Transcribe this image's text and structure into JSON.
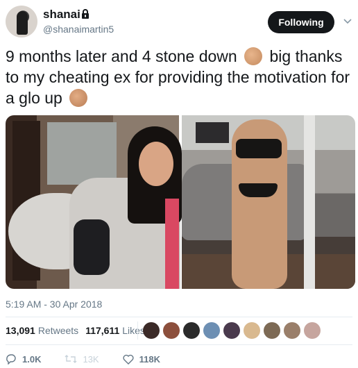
{
  "user": {
    "name": "shanai",
    "handle": "@shanaimartin5"
  },
  "follow_button": {
    "label": "Following"
  },
  "tweet": {
    "text_part1": "9 months later and 4 stone down ",
    "text_part2": " big thanks to my cheating ex for providing the motivation for a glo up ",
    "emojis": [
      "call-me-hand-icon",
      "waving-hand-icon"
    ]
  },
  "timestamp": "5:19 AM - 30 Apr 2018",
  "stats": {
    "retweets_count": "13,091",
    "retweets_label": "Retweets",
    "likes_count": "117,611",
    "likes_label": "Likes"
  },
  "likers": [
    {
      "color": "#3b2a27"
    },
    {
      "color": "#8c4f3c"
    },
    {
      "color": "#2b2b2b"
    },
    {
      "color": "#6d8fb3"
    },
    {
      "color": "#4a3a4d"
    },
    {
      "color": "#d9b98f"
    },
    {
      "color": "#7d6a55"
    },
    {
      "color": "#9a7f6a"
    },
    {
      "color": "#c6a59e"
    }
  ],
  "actions": {
    "reply_count": "1.0K",
    "retweet_count": "13K",
    "like_count": "118K"
  },
  "colors": {
    "text": "#14171a",
    "secondary": "#657786",
    "divider": "#e6ecf0",
    "button_bg": "#14171a"
  }
}
